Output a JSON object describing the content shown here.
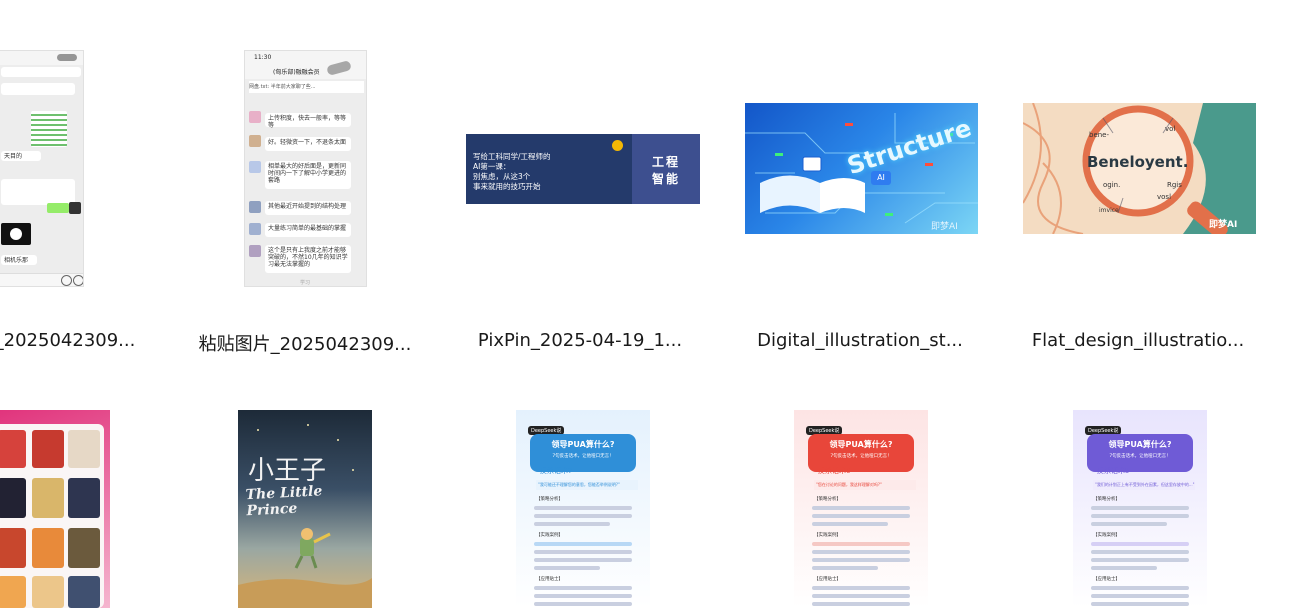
{
  "files": [
    {
      "label": "_2025042309...",
      "kind": "chat-a"
    },
    {
      "label": "粘贴图片_2025042309...",
      "kind": "chat-b"
    },
    {
      "label": "PixPin_2025-04-19_1...",
      "kind": "banner"
    },
    {
      "label": "Digital_illustration_st...",
      "kind": "structure"
    },
    {
      "label": "Flat_design_illustratio...",
      "kind": "magnifier"
    }
  ],
  "chat_a": {
    "input_hint": "+",
    "text1": "天目的",
    "text2": "相机乐那",
    "text3": "确好"
  },
  "chat_b": {
    "time": "11:30",
    "title": "(匈乐部)融融会员",
    "pin_text": "网盘.txt: 半年前大家聊了些...",
    "msgs": [
      "上传积度，快去一般率，等等等",
      "好。轻微资一下，不退条太面",
      "相单最大的好后面是，更新同时间内一下了解中小学更进的套路",
      "其他最近开始提到的结构处理",
      "大量练习简单的最基础的掌握",
      "这个是只有上我度之前才能够突破的，不然10几年的知识学习最无法掌握的"
    ],
    "footer": "学习"
  },
  "banner": {
    "line1": "写给工科同学/工程师的",
    "line2": "AI第一课：",
    "line3": "别焦虑，从这3个",
    "line4": "事来就用的技巧开始",
    "right1": "工程",
    "right2": "智能"
  },
  "structure": {
    "word": "Structure",
    "badge": "AI",
    "watermark": "即梦AI"
  },
  "magnifier": {
    "word": "Beneloyent.",
    "w1": "bene-",
    "w2": "vol",
    "w3": "ogin.",
    "w4": "Rgis",
    "w5": "vosl",
    "w6": "imvice",
    "watermark": "即梦AI"
  },
  "row2": {
    "prince_title": "小王子",
    "prince_sub": "The Little Prince",
    "posters": [
      {
        "tag": "DeepSeek说",
        "title": "领导PUA算什么?",
        "sub": "7句反击话术，让他哑口无言！",
        "case": "反杀话术7",
        "quote": "\"我可能还不理解您的意思，您能否举例说明?\"",
        "color": "#2f8fd8"
      },
      {
        "tag": "DeepSeek说",
        "title": "领导PUA算什么?",
        "sub": "7句反击话术，让他哑口无言！",
        "case": "反杀话术6",
        "quote": "\"您在讨论的问题，我这样理解对吗?\"",
        "color": "#e8463a"
      },
      {
        "tag": "DeepSeek说",
        "title": "领导PUA算什么?",
        "sub": "7句反击话术，让他哑口无言！",
        "case": "反杀话术5",
        "quote": "\"我们的计划正上有不受到外在因素，但这里存放中的...\"",
        "color": "#6f5bd6"
      }
    ],
    "section1": "【策略分析】",
    "section2": "【实践案例】",
    "section3": "【应用贴士】"
  }
}
